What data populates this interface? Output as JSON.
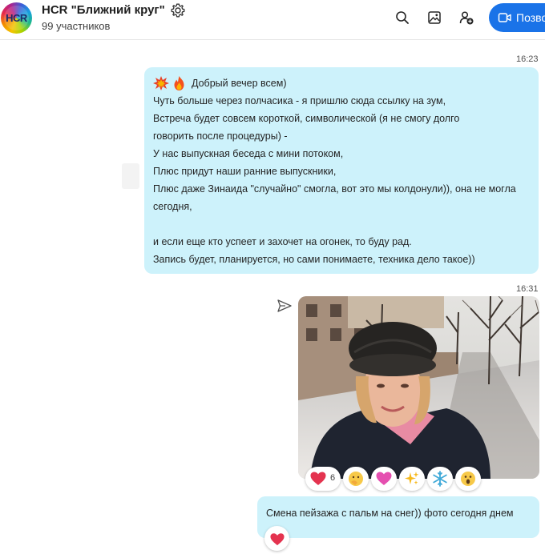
{
  "header": {
    "avatar_text": "HCR",
    "title": "HCR \"Ближний круг\"",
    "members": "99 участников",
    "call_label": "Позвонить"
  },
  "icons": [
    "gear-icon",
    "search-icon",
    "gallery-icon",
    "add-person-icon",
    "video-call-icon",
    "send-icon"
  ],
  "messages": [
    {
      "time": "16:23",
      "lines": [
        "Добрый вечер всем)",
        "Чуть больше через полчасика - я пришлю сюда ссылку на зум,",
        "Встреча будет совсем короткой, символической (я не смогу долго говорить после процедуры) -",
        "У нас выпускная беседа с мини потоком,",
        "Плюс придут наши ранние выпускники,",
        "Плюс даже Зинаида \"случайно\" смогла, вот это мы колдонули)), она не могла сегодня,",
        "и если еще кто успеет и захочет на огонек, то буду рад.",
        "Запись будет, планируется, но сами понимаете, техника дело такое))"
      ]
    },
    {
      "time": "16:31",
      "reactions": [
        {
          "icon": "heart-icon",
          "count": "6"
        },
        {
          "icon": "face-with-hand-icon",
          "count": ""
        },
        {
          "icon": "pink-heart-icon",
          "count": ""
        },
        {
          "icon": "sparkles-icon",
          "count": ""
        },
        {
          "icon": "snowflake-icon",
          "count": ""
        },
        {
          "icon": "surprised-face-icon",
          "count": ""
        }
      ]
    },
    {
      "text": "Смена пейзажа с пальм на снег)) фото сегодня днем",
      "reaction": "heart-icon"
    }
  ],
  "colors": {
    "bubble": "#cdf2fb",
    "call_button": "#1a73e8",
    "heart": "#e4334f"
  }
}
